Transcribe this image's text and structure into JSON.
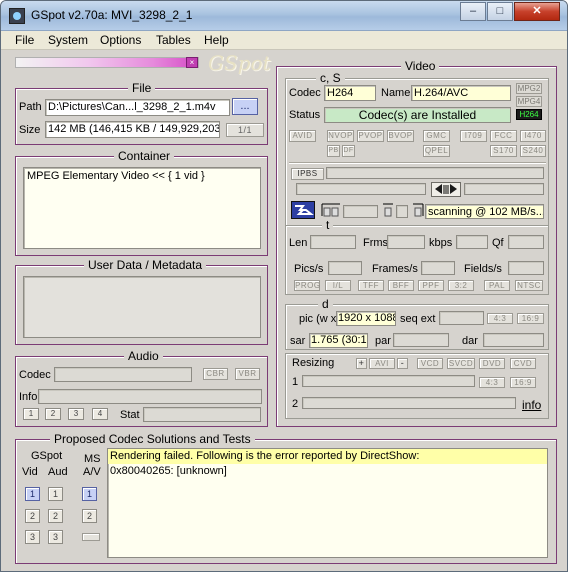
{
  "window": {
    "title": "GSpot v2.70a: MVI_3298_2_1",
    "minimize": "–",
    "maximize": "□",
    "close": "✕"
  },
  "menu": [
    "File",
    "System",
    "Options",
    "Tables",
    "Help"
  ],
  "logo": "GSpot",
  "file": {
    "title": "File",
    "path_label": "Path",
    "path_value": "D:\\Pictures\\Can...l_3298_2_1.m4v",
    "browse": "...",
    "size_label": "Size",
    "size_value": "142 MB (146,415 KB / 149,929,203",
    "counter": "1/1"
  },
  "container": {
    "title": "Container",
    "value": "MPEG Elementary Video << { 1 vid }"
  },
  "userdata": {
    "title": "User Data / Metadata"
  },
  "audio": {
    "title": "Audio",
    "codec_label": "Codec",
    "cbr": "CBR",
    "vbr": "VBR",
    "info_label": "Info",
    "streams": [
      "1",
      "2",
      "3",
      "4"
    ],
    "stat_label": "Stat"
  },
  "video": {
    "title": "Video",
    "cs_title": "c, S",
    "codec_label": "Codec",
    "codec_value": "H264",
    "name_label": "Name",
    "name_value": "H.264/AVC",
    "status_label": "Status",
    "status_value": "Codec(s) are Installed",
    "tags": [
      "MPG2",
      "MPG4",
      "H264"
    ],
    "flags_row1": [
      "AVID",
      "NVOP",
      "PVOP",
      "BVOP",
      "GMC",
      "I709",
      "FCC",
      "I470"
    ],
    "flags_row2": [
      "PB",
      "DF",
      "QPEL",
      "S170",
      "S240"
    ],
    "ipbs": "IPBS",
    "scan_value": "scanning @ 102 MB/s...",
    "t_title": "t",
    "len_label": "Len",
    "frms_label": "Frms",
    "kbps_label": "kbps",
    "qf_label": "Qf",
    "pics_label": "Pics/s",
    "frames_label": "Frames/s",
    "fields_label": "Fields/s",
    "scan_flags": [
      "PROG",
      "I/L",
      "TFF",
      "BFF",
      "PPF",
      "3:2",
      "PAL",
      "NTSC"
    ],
    "d_title": "d",
    "pic_label": "pic (w x",
    "pic_value": "1920 x 1088",
    "seqext_label": "seq ext",
    "ar_btns": [
      "4:3",
      "16:9"
    ],
    "sar_label": "sar",
    "sar_value": "1.765 (30:17)",
    "par_label": "par",
    "dar_label": "dar",
    "resizing_label": "Resizing",
    "resize_btns": [
      "+",
      "AVI",
      "-",
      "VCD",
      "SVCD",
      "DVD",
      "CVD"
    ],
    "row1_label": "1",
    "row2_label": "2",
    "info_link": "info"
  },
  "proposed": {
    "title": "Proposed Codec Solutions and Tests",
    "gspot_label": "GSpot",
    "vid_label": "Vid",
    "aud_label": "Aud",
    "ms_label": "MS",
    "av_label": "A/V",
    "nums": [
      "1",
      "2",
      "3"
    ],
    "message_line1": "Rendering failed. Following is the error reported by DirectShow:",
    "message_line2": "0x80040265: [unknown]"
  }
}
